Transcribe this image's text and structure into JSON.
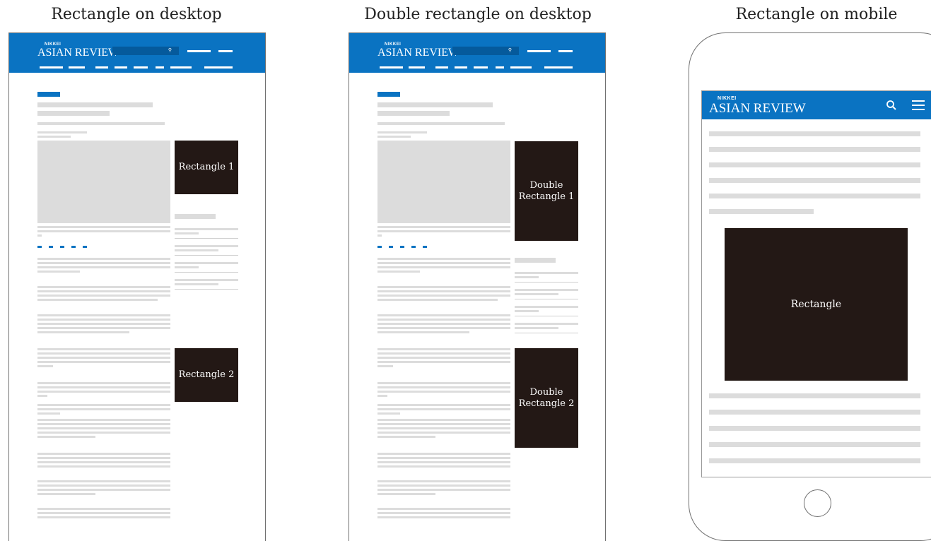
{
  "captions": {
    "left": "Rectangle on desktop",
    "middle": "Double rectangle on desktop",
    "right": "Rectangle on mobile"
  },
  "logo": {
    "brand_small": "NIKKEI",
    "brand_main": "ASIAN REVIEW"
  },
  "ads": {
    "rect1": "Rectangle 1",
    "rect2": "Rectangle 2",
    "double1": "Double\nRectangle 1",
    "double2": "Double\nRectangle 2",
    "mobile": "Rectangle"
  },
  "icons": {
    "search": "search-icon",
    "menu": "hamburger-menu-icon",
    "home_button": "home-button-icon"
  },
  "colors": {
    "header_blue": "#0a73c2",
    "ad_dark": "#231815",
    "placeholder_gray": "#dcdcdc"
  }
}
